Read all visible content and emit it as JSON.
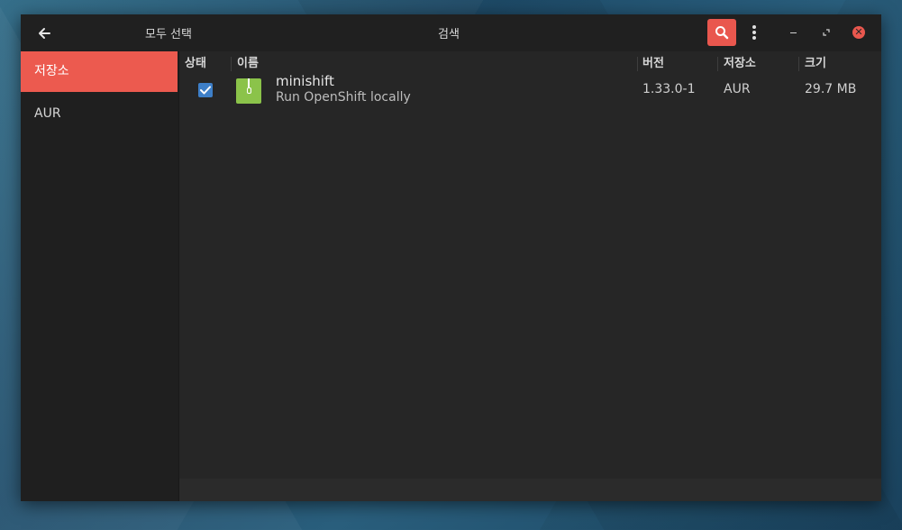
{
  "header": {
    "select_all": "모두 선택",
    "title": "검색"
  },
  "sidebar": {
    "items": [
      {
        "label": "저장소",
        "active": true
      },
      {
        "label": "AUR",
        "active": false
      }
    ]
  },
  "table": {
    "columns": [
      "상태",
      "이름",
      "버전",
      "저장소",
      "크기"
    ],
    "rows": [
      {
        "checked": true,
        "name": "minishift",
        "description": "Run OpenShift locally",
        "version": "1.33.0-1",
        "repository": "AUR",
        "size": "29.7 MB"
      }
    ]
  },
  "colors": {
    "accent": "#e9574e",
    "checkbox": "#3d7fc8",
    "package_icon": "#8bc34a"
  },
  "icons": [
    "back-arrow-icon",
    "search-icon",
    "kebab-menu-icon",
    "minimize-icon",
    "maximize-icon",
    "close-icon",
    "checkmark-icon",
    "package-icon"
  ]
}
